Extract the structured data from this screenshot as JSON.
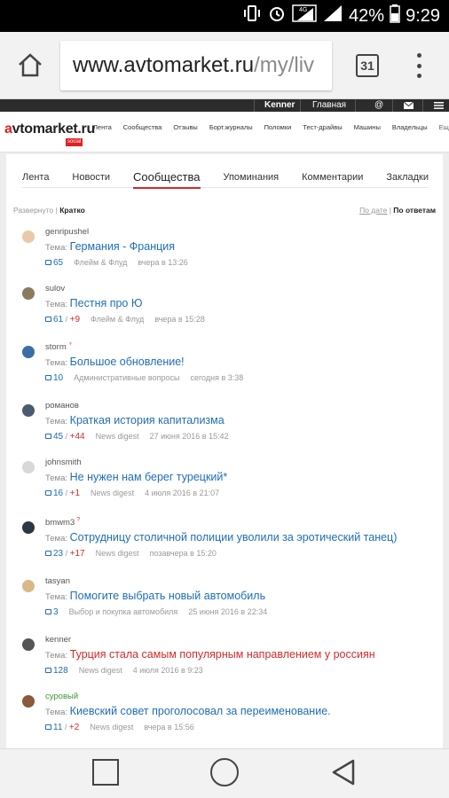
{
  "status": {
    "signal": "4G",
    "battery": "42%",
    "time": "9:29"
  },
  "browser": {
    "url_domain": "www.avtomarket.ru",
    "url_path": "/my/liv",
    "tab_count": "31",
    "home_icon": "home-icon",
    "menu_icon": "more-vert-icon"
  },
  "topbar": {
    "user": "Kenner",
    "home_link": "Главная"
  },
  "site": {
    "logo_prefix": "a",
    "logo_main": "vtomarket.ru",
    "logo_badge": "social",
    "nav": [
      "Лента",
      "Сообщества",
      "Отзывы",
      "Борт.журналы",
      "Поломки",
      "Тест-драйвы",
      "Машины",
      "Владельцы",
      "Ещё"
    ]
  },
  "tabs": [
    "Лента",
    "Новости",
    "Сообщества",
    "Упоминания",
    "Комментарии",
    "Закладки"
  ],
  "active_tab": "Сообщества",
  "view": {
    "expanded": "Развернуто",
    "short": "Кратко",
    "sort_date": "По дате",
    "sort_answers": "По ответам"
  },
  "topic_prefix": "Тема:",
  "items": [
    {
      "user": "genripushel",
      "badge": "",
      "title": "Германия - Франция",
      "title_red": false,
      "comments": "65",
      "plus": "",
      "category": "Флейм & Флуд",
      "date": "вчера в 13:26",
      "avatar_color": "#e9c9a8"
    },
    {
      "user": "sulov",
      "badge": "",
      "title": "Пестня про Ю",
      "title_red": false,
      "comments": "61",
      "plus": "+9",
      "category": "Флейм & Флуд",
      "date": "вчера в 15:28",
      "avatar_color": "#8a7a5e"
    },
    {
      "user": "storm",
      "badge": "♆",
      "title": "Большое обновление!",
      "title_red": false,
      "comments": "10",
      "plus": "",
      "category": "Административные вопросы",
      "date": "сегодня в 3:38",
      "avatar_color": "#3a6ea5"
    },
    {
      "user": "романов",
      "badge": "",
      "title": "Краткая история капитализма",
      "title_red": false,
      "comments": "45",
      "plus": "+44",
      "category": "News digest",
      "date": "27 июня 2016 в 15:42",
      "avatar_color": "#4b5a6e"
    },
    {
      "user": "johnsmith",
      "badge": "",
      "title": "Не нужен нам берег турецкий*",
      "title_red": false,
      "comments": "16",
      "plus": "+1",
      "category": "News digest",
      "date": "4 июля 2016 в 21:07",
      "avatar_color": "#d8d8d8"
    },
    {
      "user": "bmwm3",
      "badge": "?",
      "title": "Сотрудницу столичной полиции уволили за эротический танец)",
      "title_red": false,
      "comments": "23",
      "plus": "+17",
      "category": "News digest",
      "date": "позавчера в 15:20",
      "avatar_color": "#2b3742"
    },
    {
      "user": "tasyan",
      "badge": "",
      "title": "Помогите выбрать новый автомобиль",
      "title_red": false,
      "comments": "3",
      "plus": "",
      "category": "Выбор и покупка автомобиля",
      "date": "25 июня 2016 в 22:34",
      "avatar_color": "#d9b98a"
    },
    {
      "user": "kenner",
      "badge": "",
      "title": "Турция стала самым популярным направлением у россиян",
      "title_red": true,
      "comments": "128",
      "plus": "",
      "category": "News digest",
      "date": "4 июля 2016 в 9:23",
      "avatar_color": "#555555"
    },
    {
      "user": "суровый",
      "badge": "",
      "title": "Киевский совет проголосовал за переименование.",
      "title_red": false,
      "comments": "11",
      "plus": "+2",
      "category": "News digest",
      "date": "вчера в 15:56",
      "avatar_color": "#8a5a3a",
      "user_green": true
    }
  ]
}
